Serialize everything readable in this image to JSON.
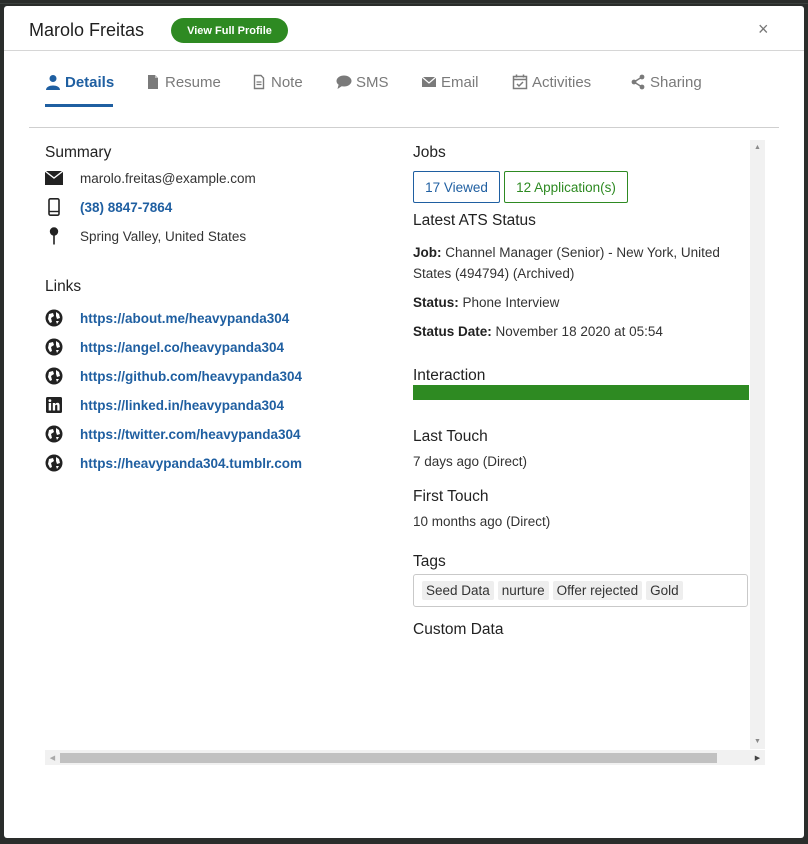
{
  "header": {
    "name": "Marolo Freitas",
    "profile_button": "View Full Profile",
    "close_label": "×"
  },
  "tabs": [
    {
      "label": "Details",
      "icon": "user-icon"
    },
    {
      "label": "Resume",
      "icon": "file-icon"
    },
    {
      "label": "Note",
      "icon": "file-text-icon"
    },
    {
      "label": "SMS",
      "icon": "chat-bubble-icon"
    },
    {
      "label": "Email",
      "icon": "envelope-icon"
    },
    {
      "label": "Activities",
      "icon": "calendar-check-icon"
    },
    {
      "label": "Sharing",
      "icon": "share-icon"
    }
  ],
  "summary": {
    "heading": "Summary",
    "email": "marolo.freitas@example.com",
    "phone": "(38) 8847-7864",
    "location": "Spring Valley, United States"
  },
  "links": {
    "heading": "Links",
    "items": [
      {
        "url": "https://about.me/heavypanda304",
        "icon": "globe-icon"
      },
      {
        "url": "https://angel.co/heavypanda304",
        "icon": "globe-icon"
      },
      {
        "url": "https://github.com/heavypanda304",
        "icon": "globe-icon"
      },
      {
        "url": "https://linked.in/heavypanda304",
        "icon": "linkedin-icon"
      },
      {
        "url": "https://twitter.com/heavypanda304",
        "icon": "globe-icon"
      },
      {
        "url": "https://heavypanda304.tumblr.com",
        "icon": "globe-icon"
      }
    ]
  },
  "jobs": {
    "heading": "Jobs",
    "viewed": "17 Viewed",
    "applications": "12 Application(s)"
  },
  "ats": {
    "heading": "Latest ATS Status",
    "job_label": "Job:",
    "job_value": "Channel Manager (Senior) - New York, United States (494794) (Archived)",
    "status_label": "Status:",
    "status_value": "Phone Interview",
    "date_label": "Status Date:",
    "date_value": "November 18 2020 at 05:54"
  },
  "interaction": {
    "heading": "Interaction",
    "level": 1.0,
    "color": "#2e8a22"
  },
  "last_touch": {
    "heading": "Last Touch",
    "value": "7 days ago (Direct)"
  },
  "first_touch": {
    "heading": "First Touch",
    "value": "10 months ago (Direct)"
  },
  "tags": {
    "heading": "Tags",
    "items": [
      "Seed Data",
      "nurture",
      "Offer rejected",
      "Gold"
    ]
  },
  "custom_data": {
    "heading": "Custom Data"
  },
  "colors": {
    "accent": "#1f5fa1",
    "success": "#2e8a22"
  }
}
